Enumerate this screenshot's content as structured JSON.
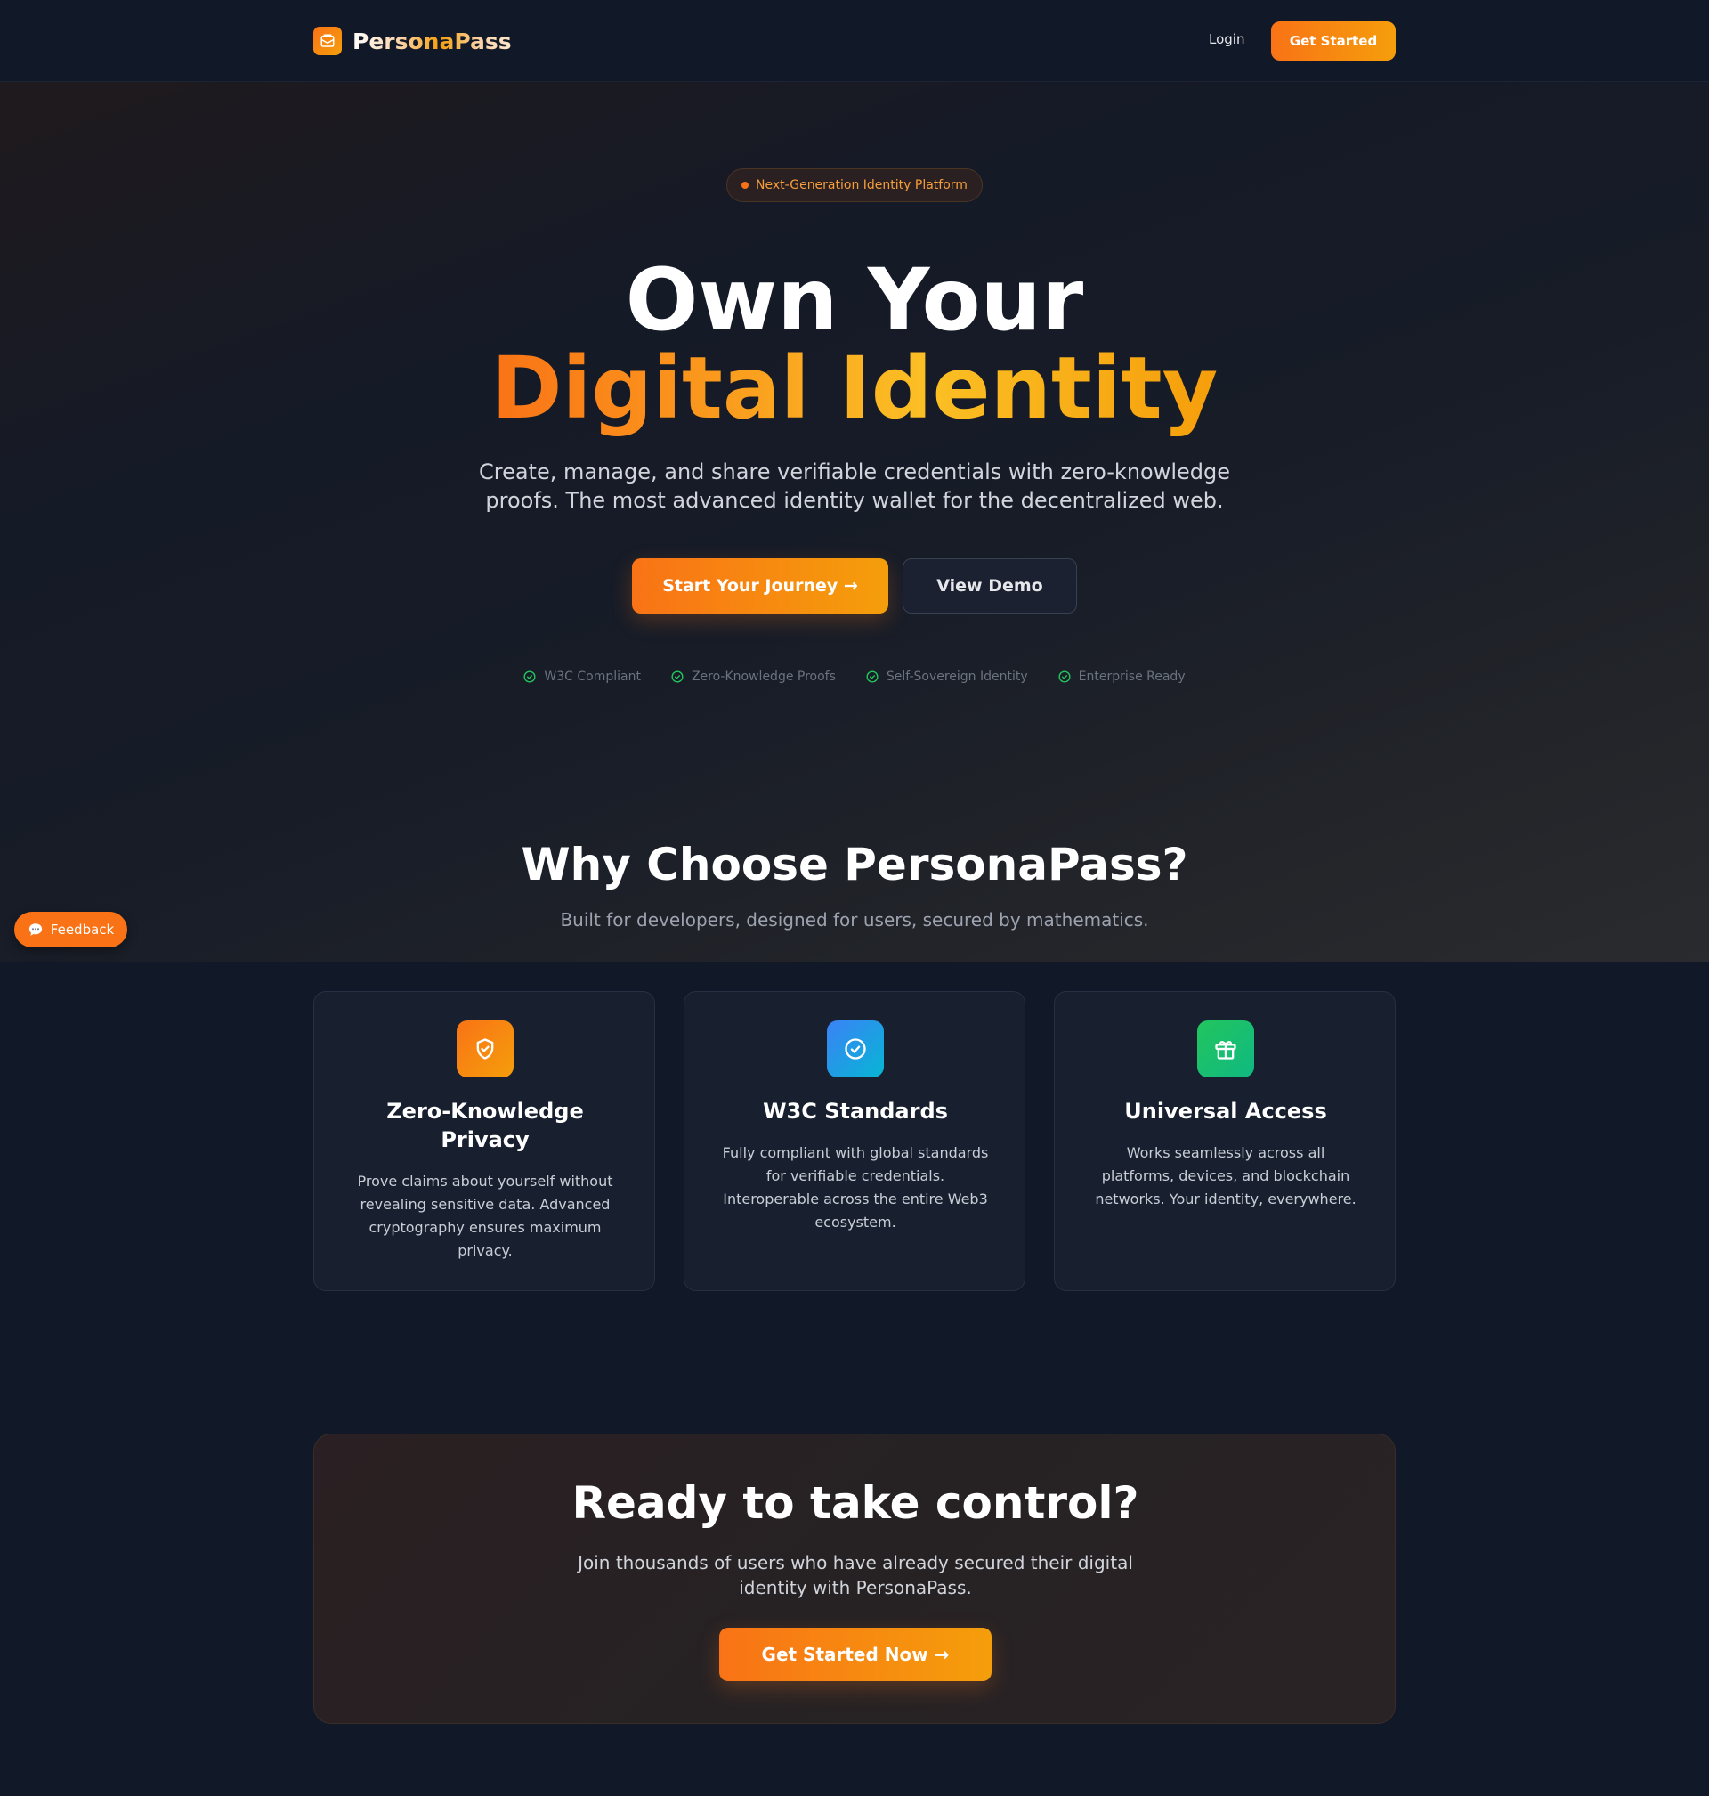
{
  "header": {
    "brand_name": "PersonaPass",
    "login_label": "Login",
    "cta_label": "Get Started"
  },
  "hero": {
    "badge": "Next-Generation Identity Platform",
    "title_line1": "Own Your",
    "title_line2": "Digital Identity",
    "subtitle": "Create, manage, and share verifiable credentials with zero-knowledge proofs. The most advanced identity wallet for the decentralized web.",
    "primary_cta": "Start Your Journey →",
    "secondary_cta": "View Demo",
    "trust_items": [
      "W3C Compliant",
      "Zero-Knowledge Proofs",
      "Self-Sovereign Identity",
      "Enterprise Ready"
    ]
  },
  "features": {
    "title": "Why Choose PersonaPass?",
    "subtitle": "Built for developers, designed for users, secured by mathematics.",
    "cards": [
      {
        "icon": "shield-check-icon",
        "title": "Zero-Knowledge Privacy",
        "description": "Prove claims about yourself without revealing sensitive data. Advanced cryptography ensures maximum privacy."
      },
      {
        "icon": "check-circle-icon",
        "title": "W3C Standards",
        "description": "Fully compliant with global standards for verifiable credentials. Interoperable across the entire Web3 ecosystem."
      },
      {
        "icon": "gift-icon",
        "title": "Universal Access",
        "description": "Works seamlessly across all platforms, devices, and blockchain networks. Your identity, everywhere."
      }
    ]
  },
  "cta": {
    "title": "Ready to take control?",
    "subtitle": "Join thousands of users who have already secured their digital identity with PersonaPass.",
    "button": "Get Started Now →"
  },
  "feedback": {
    "label": "Feedback"
  },
  "colors": {
    "accent": "#f97316",
    "accent_end": "#f59e0b",
    "background": "#111827",
    "card": "#182030",
    "success": "#22c55e"
  }
}
